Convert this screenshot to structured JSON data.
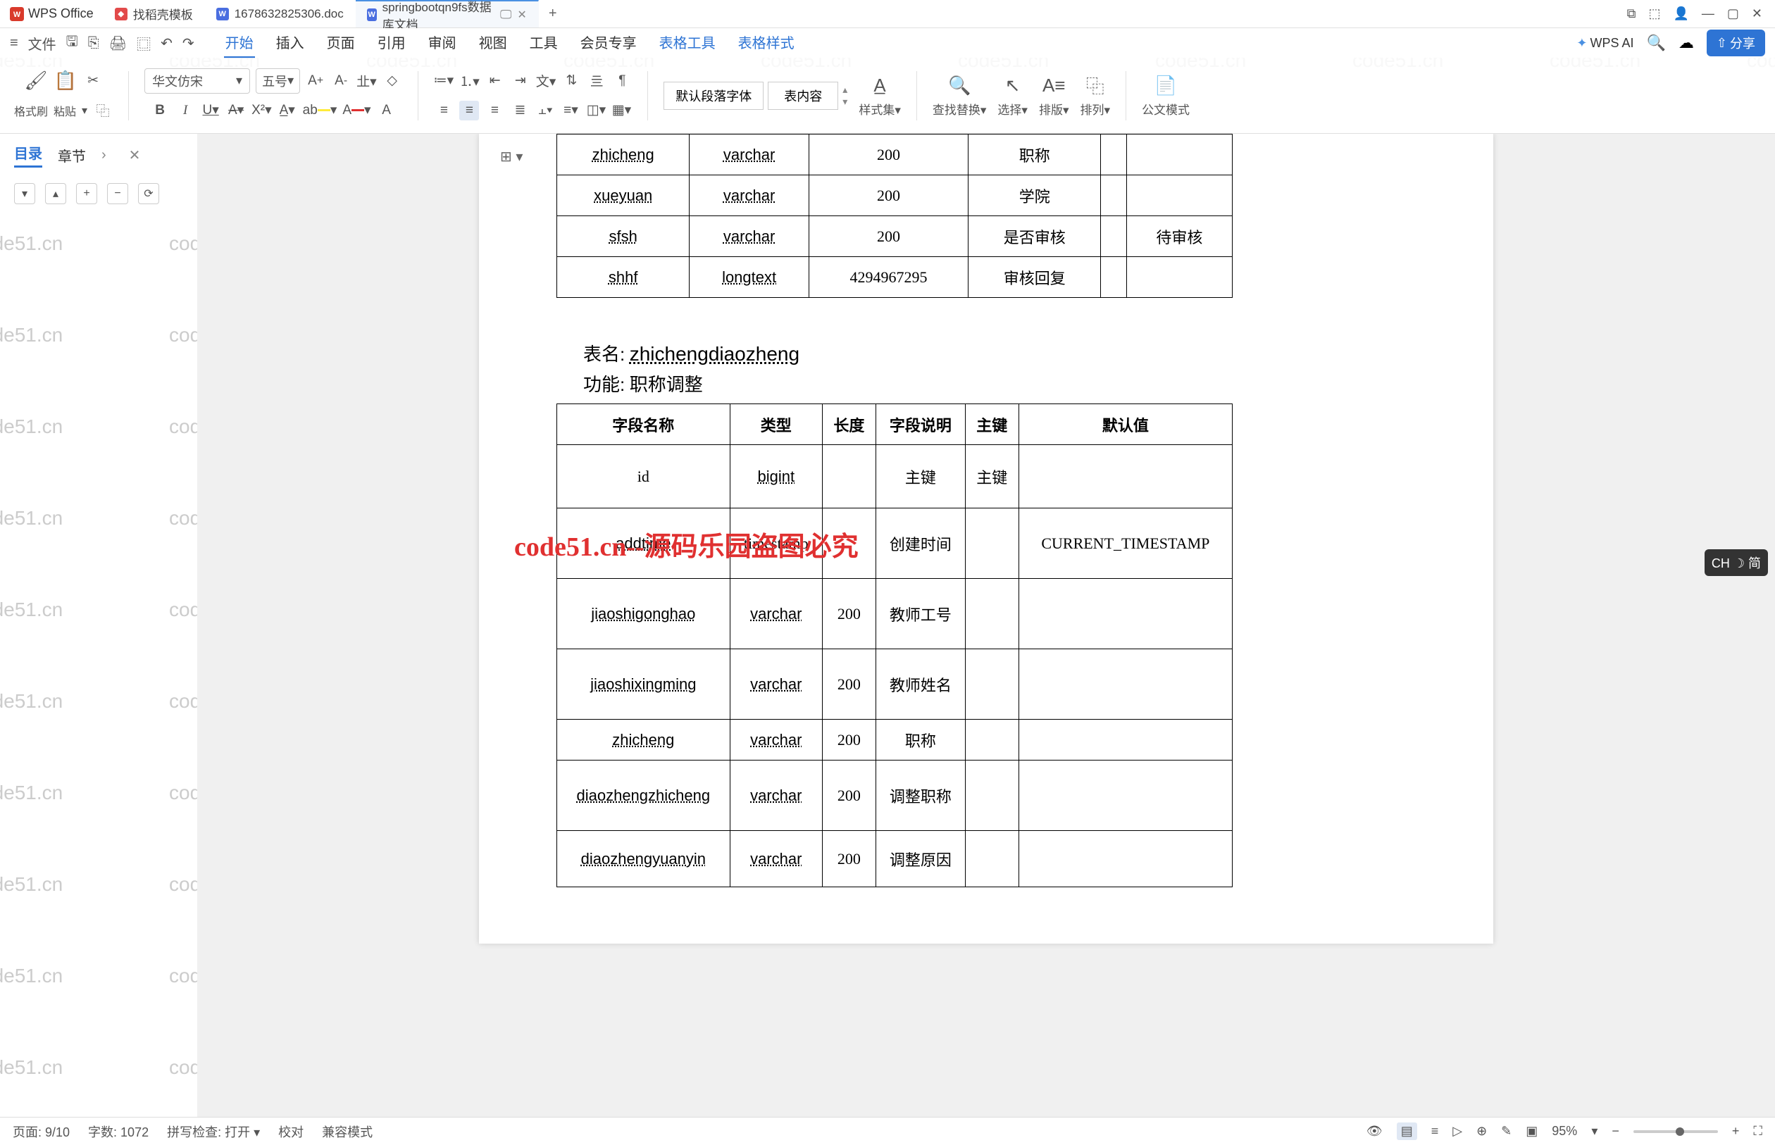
{
  "app_name": "WPS Office",
  "tabs": [
    {
      "icon": "d",
      "label": "找稻壳模板"
    },
    {
      "icon": "w",
      "label": "1678632825306.doc"
    },
    {
      "icon": "w",
      "label": "springbootqn9fs数据库文档",
      "active": true,
      "ext": "🖵"
    }
  ],
  "menu_left": {
    "file": "文件"
  },
  "menus": [
    "开始",
    "插入",
    "页面",
    "引用",
    "审阅",
    "视图",
    "工具",
    "会员专享",
    "表格工具",
    "表格样式"
  ],
  "active_menu": 0,
  "wps_ai": "WPS AI",
  "share": "分享",
  "ribbon": {
    "format_brush": "格式刷",
    "paste": "粘贴",
    "font": "华文仿宋",
    "size": "五号",
    "para_font": "默认段落字体",
    "table_content": "表内容",
    "styles": "样式集",
    "find": "查找替换",
    "select": "选择",
    "layout": "排版",
    "arrange": "排列",
    "official": "公文模式"
  },
  "sidebar": {
    "outline": "目录",
    "chapter": "章节"
  },
  "doc": {
    "table1_rows": [
      {
        "c1": "zhicheng",
        "c2": "varchar",
        "c3": "200",
        "c4": "职称",
        "c5": "",
        "c6": ""
      },
      {
        "c1": "xueyuan",
        "c2": "varchar",
        "c3": "200",
        "c4": "学院",
        "c5": "",
        "c6": ""
      },
      {
        "c1": "sfsh",
        "c2": "varchar",
        "c3": "200",
        "c4": "是否审核",
        "c5": "",
        "c6": "待审核"
      },
      {
        "c1": "shhf",
        "c2": "longtext",
        "c3": "4294967295",
        "c4": "审核回复",
        "c5": "",
        "c6": ""
      }
    ],
    "table_name_label": "表名:",
    "table_name": "zhichengdiaozheng",
    "func_label": "功能:",
    "func": "职称调整",
    "watermark_text": "code51.cn--源码乐园盗图必究",
    "t2_headers": [
      "字段名称",
      "类型",
      "长度",
      "字段说明",
      "主键",
      "默认值"
    ],
    "t2_rows": [
      {
        "c1": "id",
        "c2": "bigint",
        "c3": "",
        "c4": "主键",
        "c5": "主键",
        "c6": ""
      },
      {
        "c1": "addtime",
        "c2": "timestamp",
        "c3": "",
        "c4": "创建时间",
        "c5": "",
        "c6": "CURRENT_TIMESTAMP"
      },
      {
        "c1": "jiaoshigonghao",
        "c2": "varchar",
        "c3": "200",
        "c4": "教师工号",
        "c5": "",
        "c6": ""
      },
      {
        "c1": "jiaoshixingming",
        "c2": "varchar",
        "c3": "200",
        "c4": "教师姓名",
        "c5": "",
        "c6": ""
      },
      {
        "c1": "zhicheng",
        "c2": "varchar",
        "c3": "200",
        "c4": "职称",
        "c5": "",
        "c6": ""
      },
      {
        "c1": "diaozhengzhicheng",
        "c2": "varchar",
        "c3": "200",
        "c4": "调整职称",
        "c5": "",
        "c6": ""
      },
      {
        "c1": "diaozhengyuanyin",
        "c2": "varchar",
        "c3": "200",
        "c4": "调整原因",
        "c5": "",
        "c6": ""
      }
    ]
  },
  "status": {
    "page": "页面: 9/10",
    "words": "字数: 1072",
    "spell": "拼写检查: 打开",
    "proof": "校对",
    "compat": "兼容模式",
    "zoom": "95%"
  },
  "ime": "CH ☽ 简",
  "watermark": "code51.cn"
}
